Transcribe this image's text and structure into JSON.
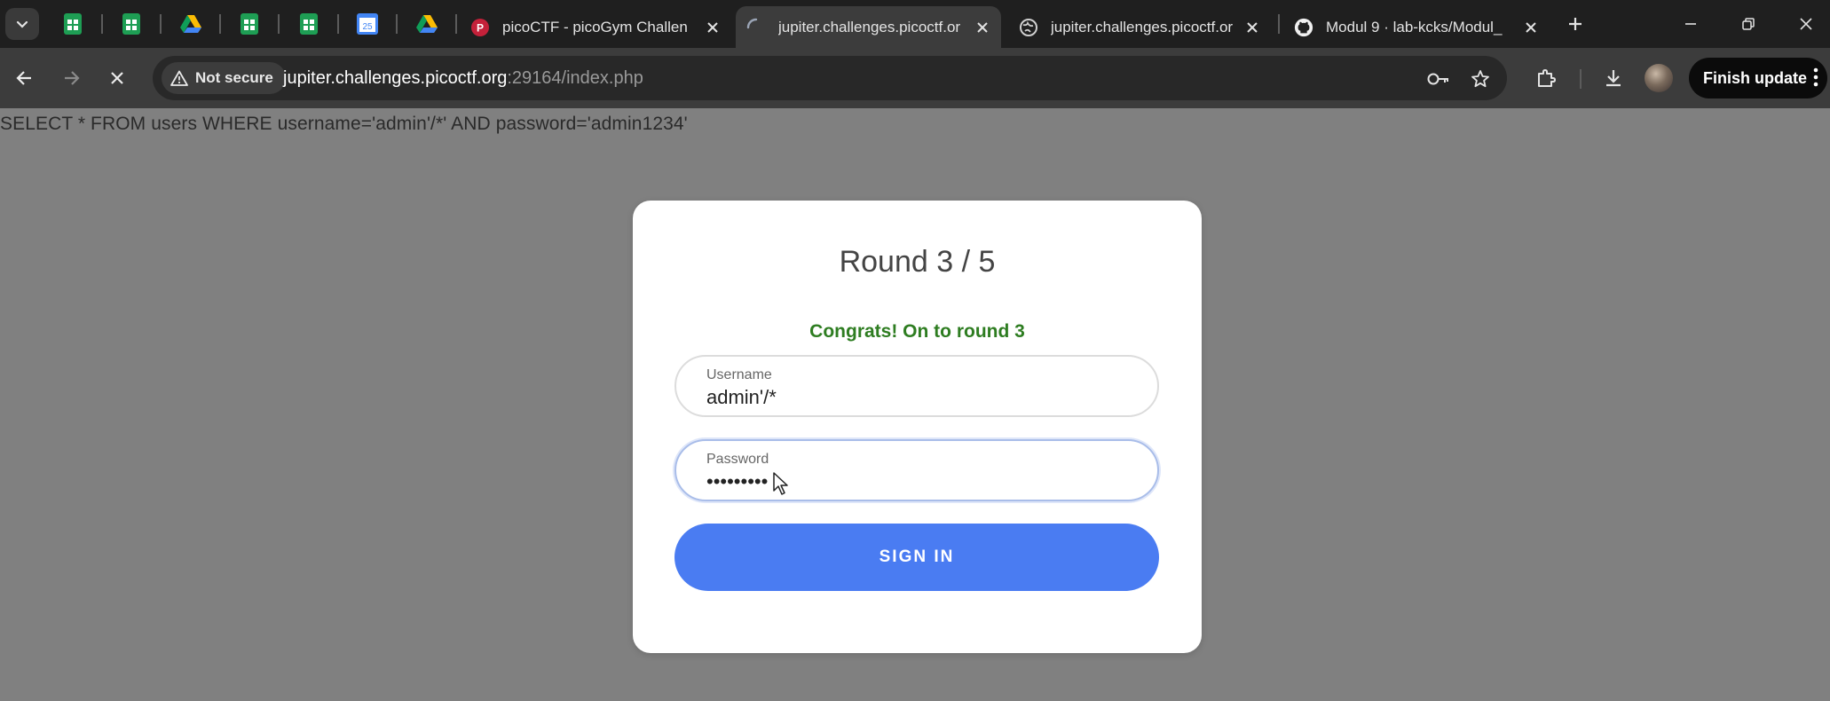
{
  "browser": {
    "tabs": [
      {
        "title": "picoCTF - picoGym Challen",
        "active": false
      },
      {
        "title": "jupiter.challenges.picoctf.or",
        "active": true
      },
      {
        "title": "jupiter.challenges.picoctf.or",
        "active": false
      },
      {
        "title": "Modul 9 · lab-kcks/Modul_",
        "active": false
      }
    ],
    "pinned_icons": [
      "sheets-icon",
      "sheets-icon",
      "drive-icon",
      "sheets-icon",
      "sheets-icon",
      "calendar-icon",
      "drive-icon"
    ],
    "calendar_day": "25",
    "security_chip": "Not secure",
    "url_host": "jupiter.challenges.picoctf.org",
    "url_rest": ":29164/index.php",
    "finish_update": "Finish update"
  },
  "page": {
    "sql_query": "SELECT * FROM users WHERE username='admin'/*' AND password='admin1234'",
    "round_title": "Round 3 / 5",
    "message": "Congrats! On to round 3",
    "username": {
      "label": "Username",
      "value": "admin'/*"
    },
    "password": {
      "label": "Password",
      "value": "admin1234"
    },
    "signin_label": "SIGN IN"
  },
  "colors": {
    "accent_button": "#4a7cf2",
    "success_text": "#2e7d21",
    "page_background": "#808080"
  }
}
